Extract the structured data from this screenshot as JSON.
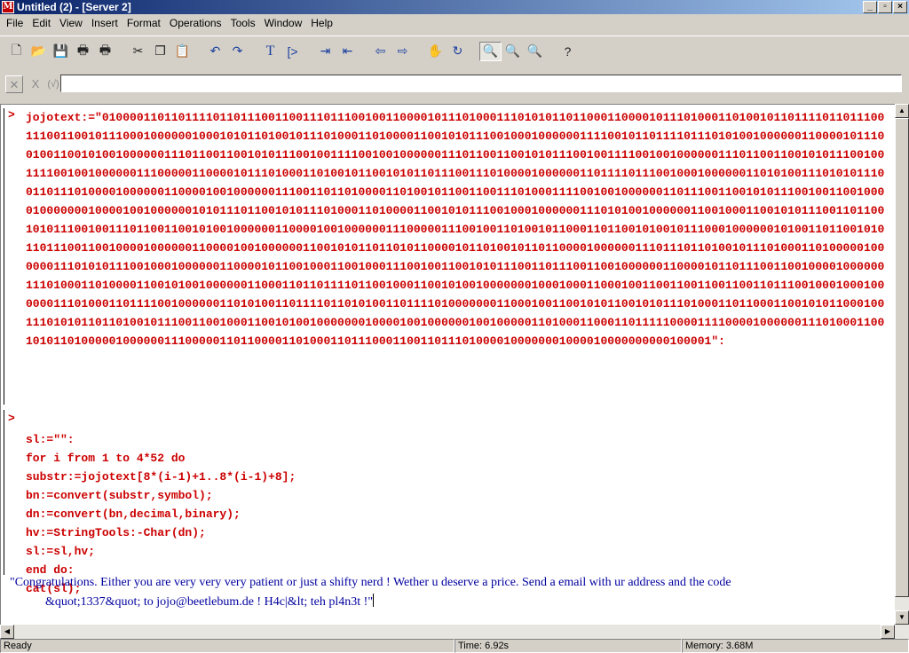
{
  "window": {
    "title": "Untitled (2) - [Server 2]",
    "app_icon": "maple-leaf-icon",
    "buttons": [
      "_",
      "▫",
      "×"
    ]
  },
  "menu": [
    "File",
    "Edit",
    "View",
    "Insert",
    "Format",
    "Operations",
    "Tools",
    "Window",
    "Help"
  ],
  "toolbar": {
    "icons": [
      "new-icon",
      "open-icon",
      "save-icon",
      "print-icon",
      "print-preview-icon",
      "cut-icon",
      "copy-icon",
      "paste-icon",
      "undo-icon",
      "redo-icon",
      "text-icon",
      "input-icon",
      "indent-icon",
      "outdent-icon",
      "back-icon",
      "forward-icon",
      "stop-icon",
      "restart-icon",
      "zoom-100-icon",
      "zoom-in-icon",
      "zoom-out-icon",
      "help-icon"
    ]
  },
  "inputbar": {
    "cancel_glyph": "✕",
    "x_glyph": "X",
    "check_glyph": "(√)",
    "value": ""
  },
  "worksheet": {
    "prompt_symbol": ">",
    "jojotext": "jojotext:=\"0100001101101111011011100110011101110010011000010111010001110101011011000110000101110100011010010110111101101110011100110010111000100000010001010110100101110100011010000110010101110010001000000111100101101111011101010010000001100001011100100110010100100000011101100110010101110010011110010010000001110110011001010111001001111001001000000111011001100101011100100111100100100000011100000110000101110100011010010110010101101110011101000010000001101111011100100010000001101010011101010111001101110100001000000110000100100000011100110110100001101001011001100111010001111001001000000110111001100101011100100110010000100000001000010010000001010111011001010111010001101000011001010111001000100000011101010010000001100100011001010111001101100101011100100111011001100101001000000110000100100000011100000111001001101001011000110110010100101110001000000101001101100101011011100110010000100000011000010010000001100101011011010110000101101001011011000010000001110111011010010111010001101000001000000111010101110010001000000110000101100100011001000111001001100101011100110111001100100000011000010110111001100100001000000111010001101000011001010010000001100011011011110110010001100101001000000010001000110001001100110011001100110111001000100010000001110100011011110010000001101010011011110110101001101111010000000110001001100101011001010111010001101100011001010110001001110101011011010010111001100100011001010010000000100001001000000100100000110100011000110111110000111100001000000111010001100101011010000010000001110000011011000011010001101110001100110111010000100000001000010000000000100001\":",
    "code_lines": [
      "sl:=\"\":",
      "for i from 1 to 4*52 do",
      "substr:=jojotext[8*(i-1)+1..8*(i-1)+8];",
      "bn:=convert(substr,symbol);",
      "dn:=convert(bn,decimal,binary);",
      "hv:=StringTools:-Char(dn);",
      "sl:=sl,hv;",
      "end do:",
      "cat(sl);"
    ],
    "output_line1": "\"Congratulations. Either you are very very very patient or just a shifty nerd ! Wether u deserve a price. Send a email with ur address and the code",
    "output_line2": "&quot;1337&quot; to jojo@beetlebum.de ! H4c|&lt; teh pl4n3t !\""
  },
  "status": {
    "ready": "Ready",
    "time": "Time: 6.92s",
    "memory": "Memory: 3.68M"
  }
}
